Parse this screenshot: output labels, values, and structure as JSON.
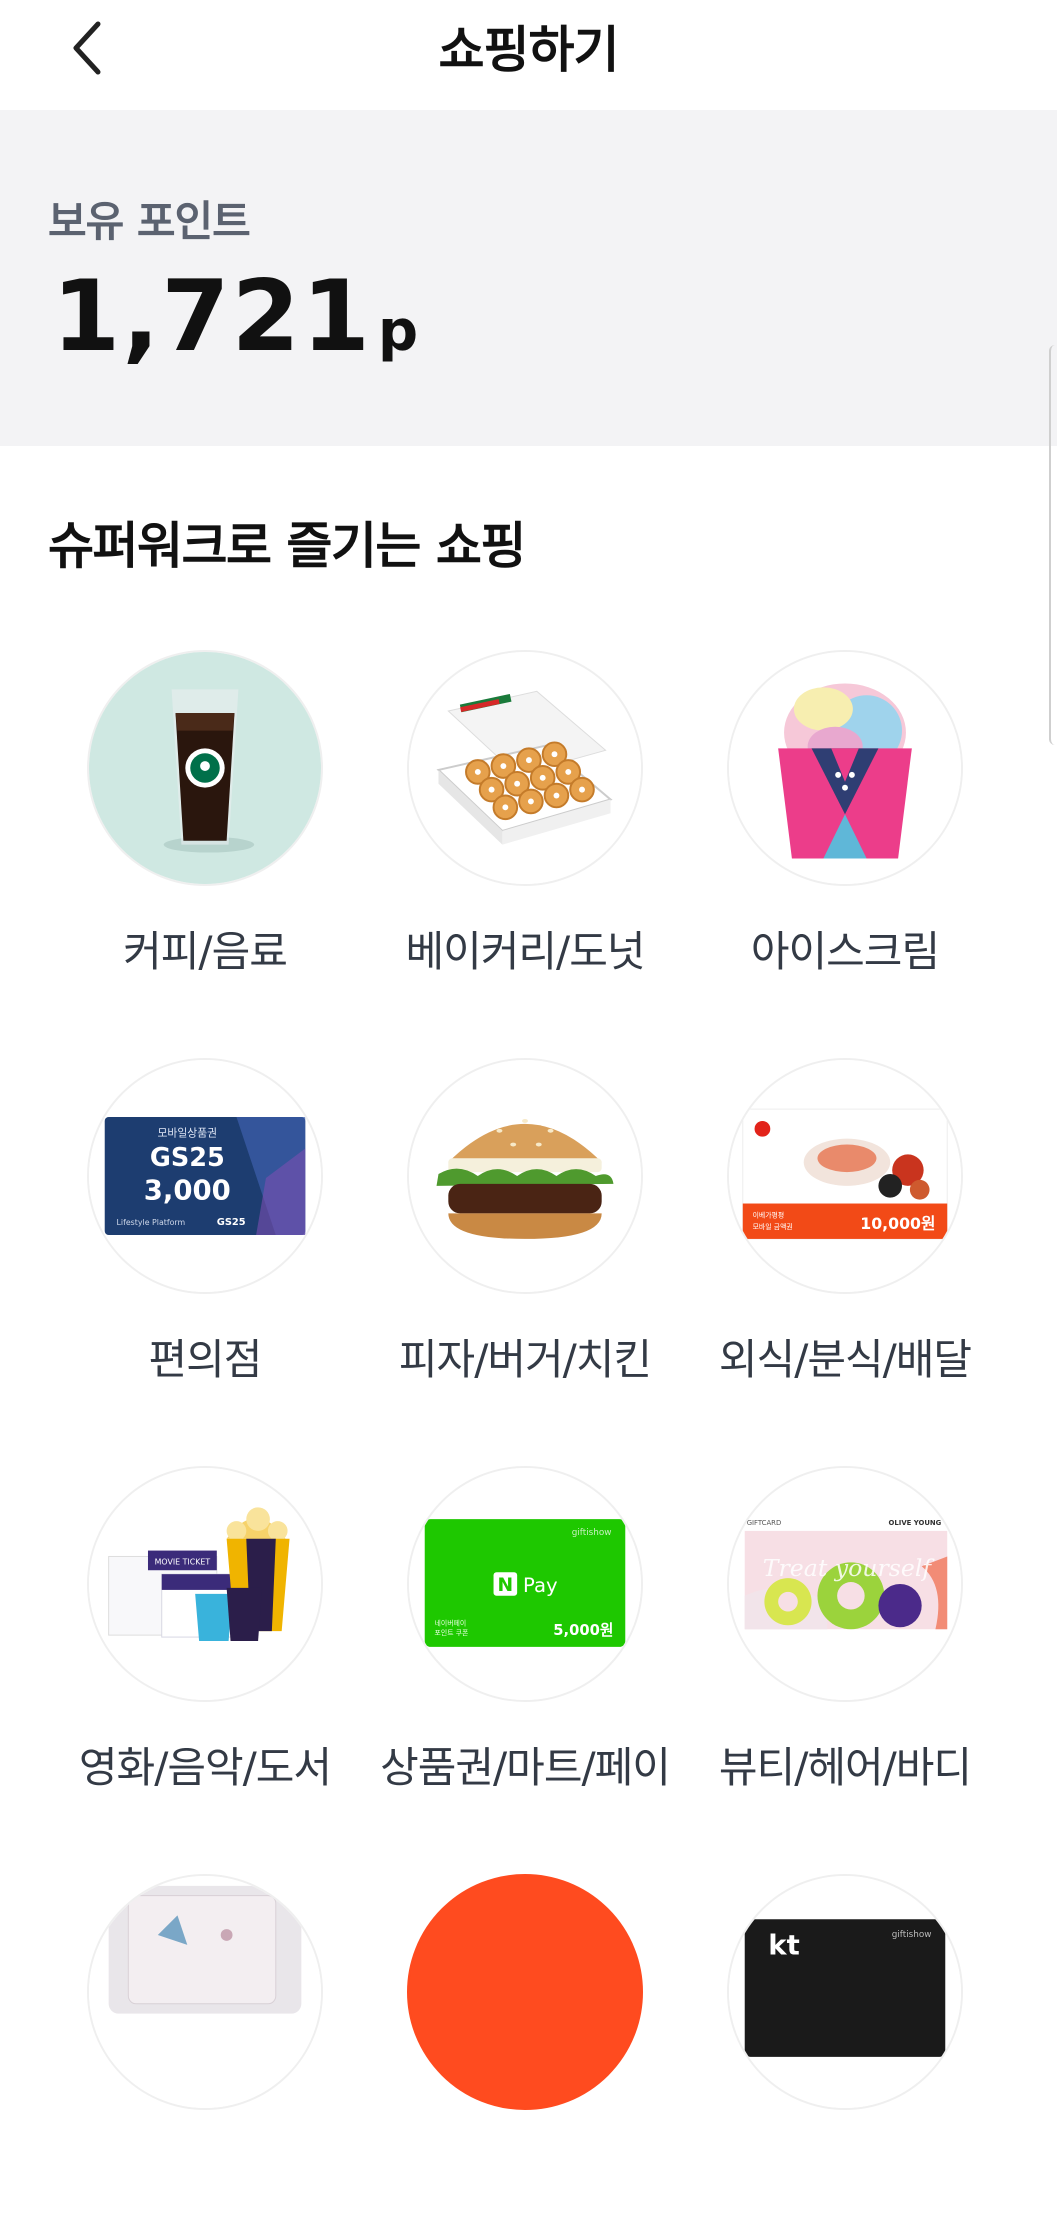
{
  "header": {
    "title": "쇼핑하기",
    "back_icon": "chevron-left-icon"
  },
  "points": {
    "label": "보유 포인트",
    "value": "1,721",
    "unit": "p"
  },
  "section": {
    "title": "슈퍼워크로 즐기는 쇼핑"
  },
  "categories": [
    {
      "label": "커피/음료"
    },
    {
      "label": "베이커리/도넛"
    },
    {
      "label": "아이스크림"
    },
    {
      "label": "편의점",
      "card": {
        "top": "모바일상품권",
        "brand": "GS25",
        "amount": "3,000",
        "footer": "Lifestyle Platform",
        "footer_brand": "GS25"
      }
    },
    {
      "label": "피자/버거/치킨"
    },
    {
      "label": "외식/분식/배달",
      "card": {
        "amount": "10,000원",
        "caption_1": "이베가평평",
        "caption_2": "모바일 금액권"
      }
    },
    {
      "label": "영화/음악/도서",
      "card": {
        "ticket": "MOVIE TICKET"
      }
    },
    {
      "label": "상품권/마트/페이",
      "card": {
        "brand": "N",
        "pay": "Pay",
        "amount": "5,000원",
        "corner": "giftishow",
        "caption_1": "네이버페이",
        "caption_2": "포인트 쿠폰"
      }
    },
    {
      "label": "뷰티/헤어/바디",
      "card": {
        "top_left": "GIFTCARD",
        "top_right": "OLIVE YOUNG",
        "script": "Treat yourself"
      }
    },
    {
      "label": ""
    },
    {
      "label": ""
    },
    {
      "label": "",
      "card": {
        "brand": "kt",
        "corner": "giftishow"
      }
    }
  ],
  "colors": {
    "accent_red": "#ff4b1f",
    "gs_blue": "#1d3d70",
    "naver_green": "#1ec800",
    "coffee_bg": "#cfe8e2"
  }
}
